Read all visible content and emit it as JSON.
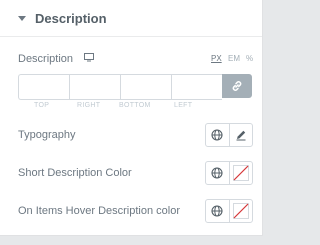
{
  "section": {
    "title": "Description"
  },
  "description": {
    "label": "Description",
    "units": [
      "PX",
      "EM",
      "%"
    ],
    "active_unit": "PX",
    "dimension_labels": [
      "TOP",
      "RIGHT",
      "BOTTOM",
      "LEFT"
    ],
    "values": [
      "",
      "",
      "",
      ""
    ]
  },
  "controls": [
    {
      "label": "Typography"
    },
    {
      "label": "Short Description Color"
    },
    {
      "label": "On Items Hover Description color"
    }
  ],
  "colors": {
    "panel_bg": "#ffffff",
    "page_bg": "#e6e8ea",
    "text": "#6d7882",
    "link_btn": "#a4afb7",
    "clear_red": "#d63638"
  }
}
